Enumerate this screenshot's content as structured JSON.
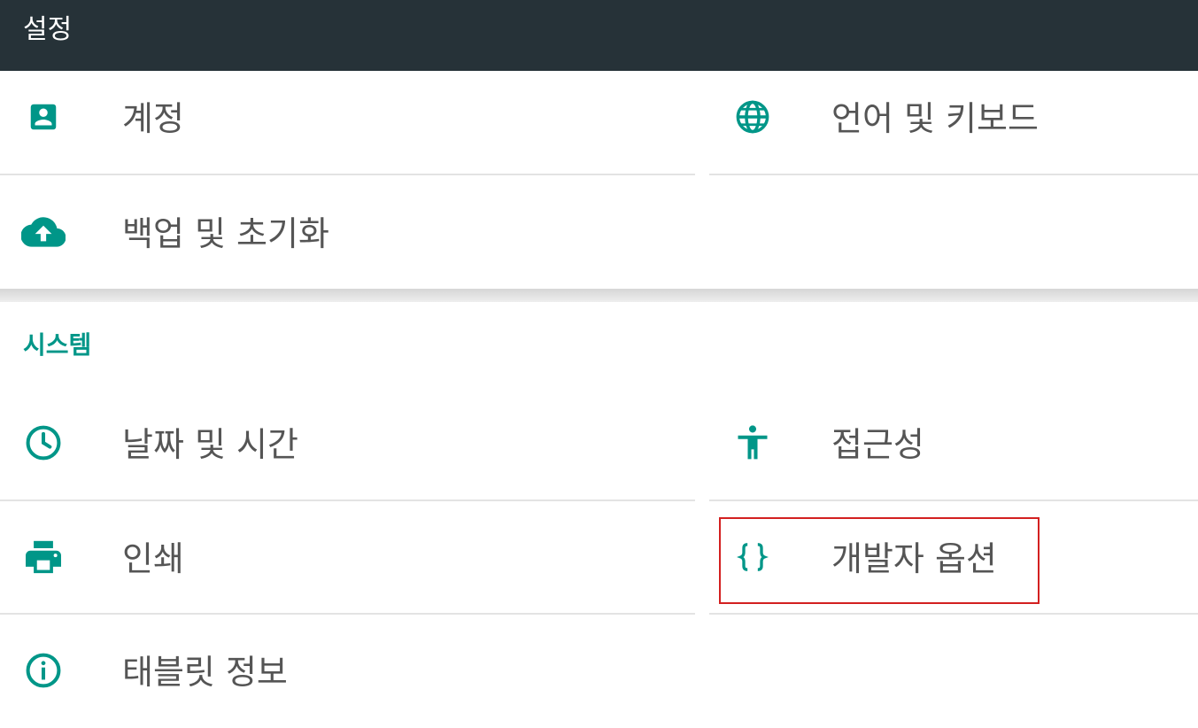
{
  "app_bar": {
    "title": "설정"
  },
  "accent_color": "#009688",
  "header_color": "#263238",
  "top_section": {
    "items": [
      {
        "label": "계정",
        "icon": "account-box-icon"
      },
      {
        "label": "언어 및 키보드",
        "icon": "globe-icon"
      },
      {
        "label": "백업 및 초기화",
        "icon": "cloud-upload-icon"
      }
    ]
  },
  "system_section": {
    "header": "시스템",
    "items": [
      {
        "label": "날짜 및 시간",
        "icon": "clock-icon"
      },
      {
        "label": "접근성",
        "icon": "accessibility-icon"
      },
      {
        "label": "인쇄",
        "icon": "printer-icon"
      },
      {
        "label": "개발자 옵션",
        "icon": "code-braces-icon",
        "highlighted": true
      },
      {
        "label": "태블릿 정보",
        "icon": "info-icon"
      }
    ]
  }
}
